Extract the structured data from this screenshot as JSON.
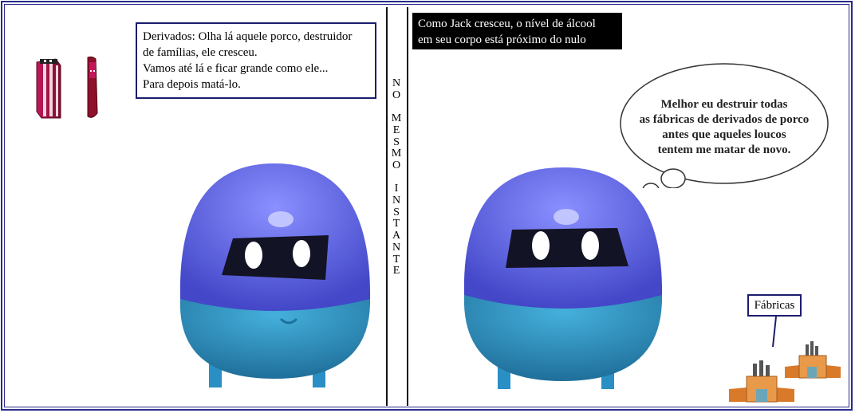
{
  "panel_left": {
    "caption_lines": [
      "Derivados: Olha lá aquele porco, destruidor",
      "de famílias, ele cresceu.",
      "Vamos até lá e ficar grande como ele...",
      "Para depois matá-lo."
    ]
  },
  "divider_text": [
    "N",
    "O",
    "",
    "M",
    "E",
    "S",
    "M",
    "O",
    "",
    "I",
    "N",
    "S",
    "T",
    "A",
    "N",
    "T",
    "E"
  ],
  "panel_right": {
    "narration_lines": [
      "Como Jack cresceu, o nível de álcool",
      "em seu corpo está próximo do nulo"
    ],
    "thought_lines": [
      "Melhor eu destruir todas",
      "as fábricas de derivados de porco",
      "antes que aqueles loucos",
      "tentem me matar de novo."
    ],
    "factory_label": "Fábricas"
  },
  "colors": {
    "border": "#2a2a8a",
    "character_top": "#5a60e0",
    "character_bottom": "#2f8fc0",
    "factory": "#e08a3a"
  },
  "icons": [
    "can-icon",
    "bottle-icon",
    "character-icon",
    "factory-icon"
  ]
}
